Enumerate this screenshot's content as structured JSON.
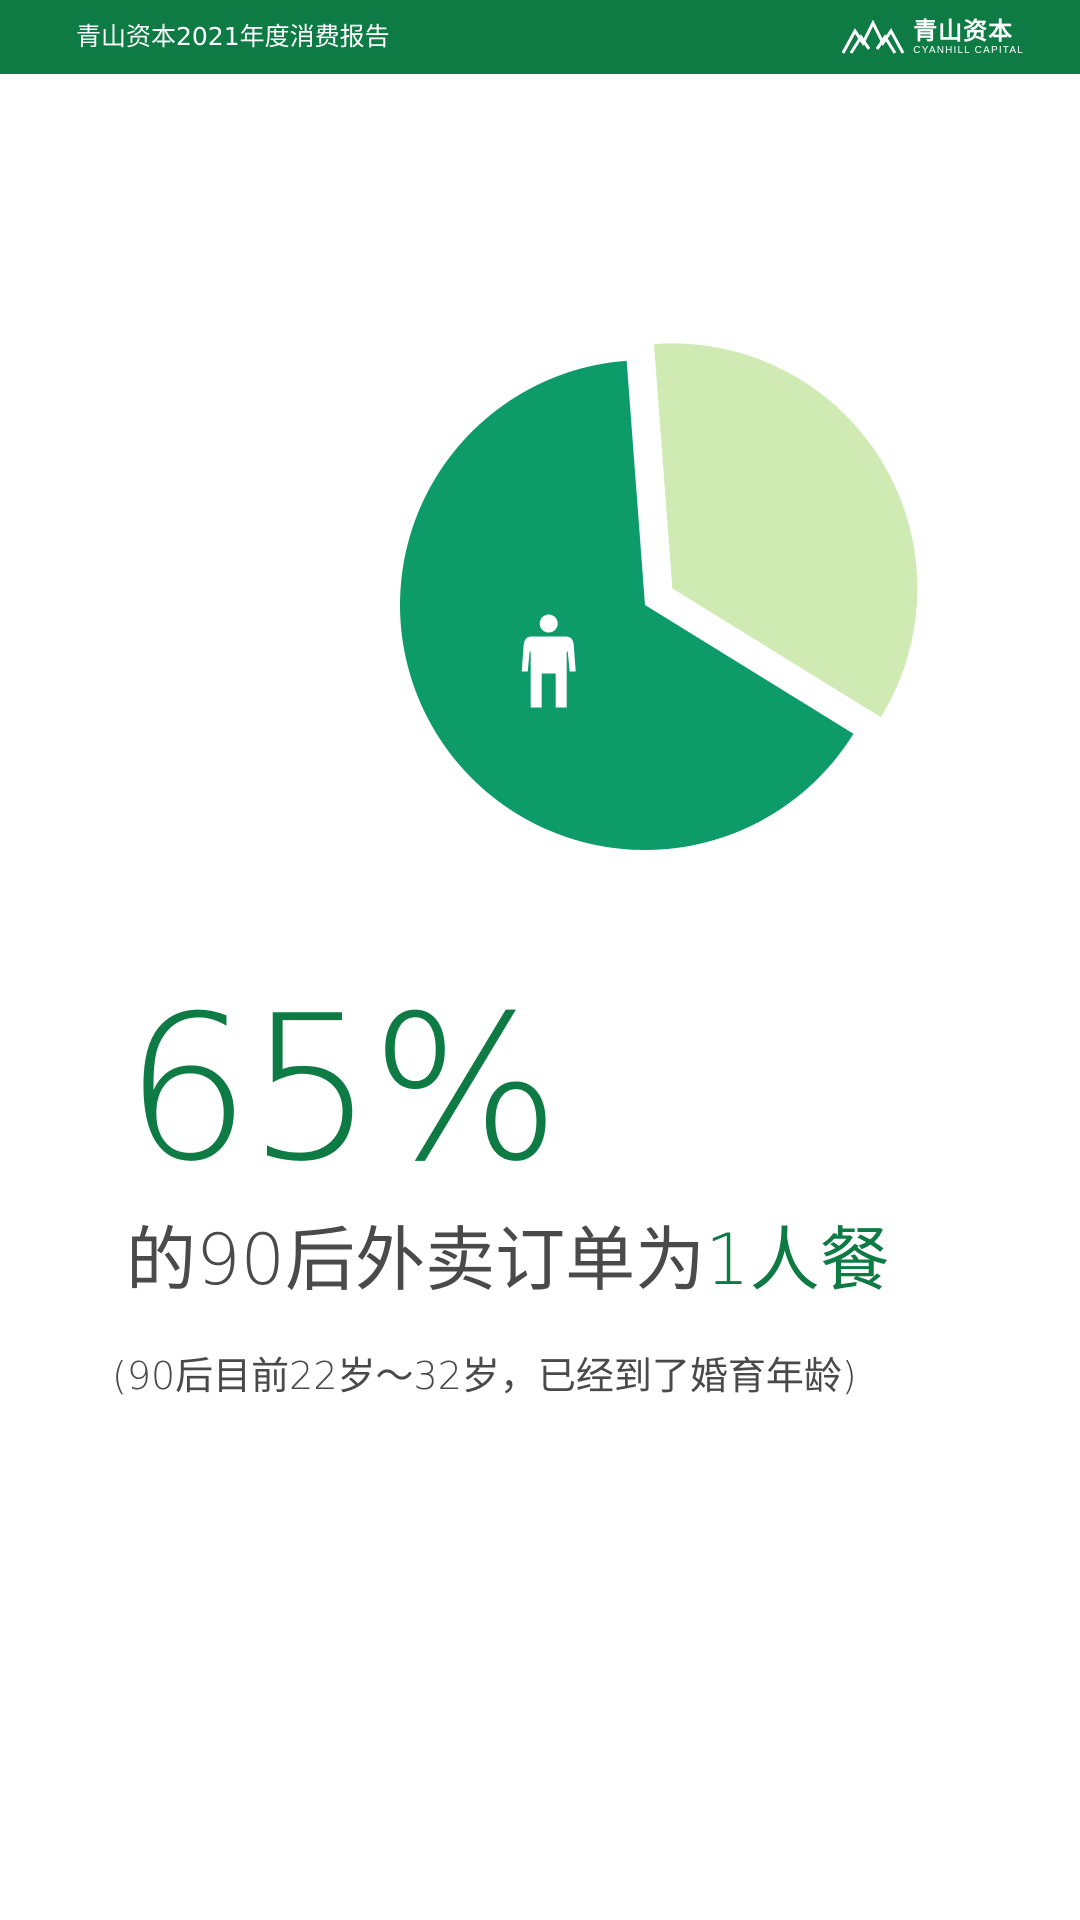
{
  "header": {
    "report_title": "青山资本2021年度消费报告",
    "logo_cn": "青山资本",
    "logo_en": "CYANHILL CAPITAL",
    "bg_color": "#0e7a44"
  },
  "chart_data": {
    "type": "pie",
    "title": "",
    "slices": [
      {
        "label": "1人餐",
        "value": 65,
        "color": "#0e9b6a",
        "icon": "person-icon"
      },
      {
        "label": "",
        "value": 35,
        "color": "#cfeab2",
        "exploded": true
      }
    ]
  },
  "stat": {
    "value": "65%",
    "text_prefix": "的90后外卖订单为",
    "text_accent": "1人餐",
    "note": "(90后目前22岁～32岁，已经到了婚育年龄)"
  },
  "colors": {
    "accent": "#0e7a44",
    "text": "#4a4a4a"
  }
}
